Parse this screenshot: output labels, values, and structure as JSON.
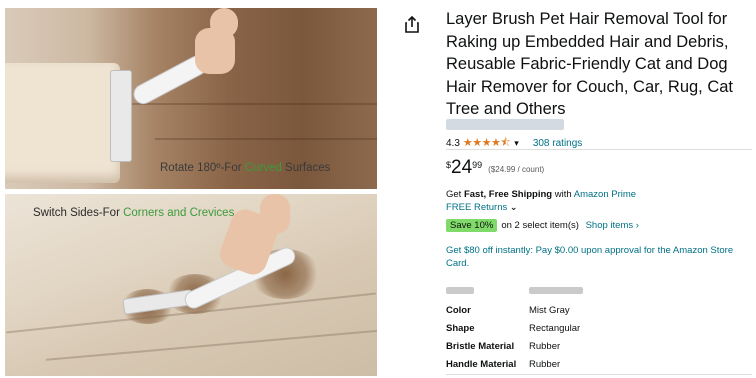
{
  "images": {
    "top_caption_prefix": "Rotate 180º-For ",
    "top_caption_highlight": "Curved",
    "top_caption_suffix": " Surfaces",
    "bottom_caption_prefix": "Switch Sides-For ",
    "bottom_caption_highlight": "Corners and Crevices",
    "highlight_color": "#3c9b3c"
  },
  "actions": {
    "share_icon": "share-icon"
  },
  "product": {
    "title": "Layer Brush Pet Hair Removal Tool for Raking up Embedded Hair and Debris, Reusable Fabric-Friendly Cat and Dog Hair Remover for Couch, Car, Rug, Cat Tree and Others"
  },
  "rating": {
    "value": "4.3",
    "stars": "★★★★⯪",
    "count_label": "308 ratings",
    "star_color": "#de7921"
  },
  "price": {
    "symbol": "$",
    "whole": "24",
    "fraction": "99",
    "unit": "($24.99 / count)"
  },
  "shipping": {
    "get": "Get ",
    "fast_free": "Fast, Free Shipping",
    "with": " with ",
    "prime_link": "Amazon Prime",
    "returns": "FREE Returns",
    "returns_chevron": "⌄"
  },
  "coupon": {
    "badge": "Save 10%",
    "text": "on 2 select item(s)",
    "link": "Shop items ›",
    "badge_color": "#7fda69"
  },
  "offer": {
    "text": "Get $80 off instantly: Pay $0.00 upon approval for the Amazon Store Card."
  },
  "specs": [
    {
      "key": "Color",
      "value": "Mist Gray"
    },
    {
      "key": "Shape",
      "value": "Rectangular"
    },
    {
      "key": "Bristle Material",
      "value": "Rubber"
    },
    {
      "key": "Handle Material",
      "value": "Rubber"
    }
  ],
  "colors": {
    "link": "#007185",
    "text": "#0f1111"
  }
}
